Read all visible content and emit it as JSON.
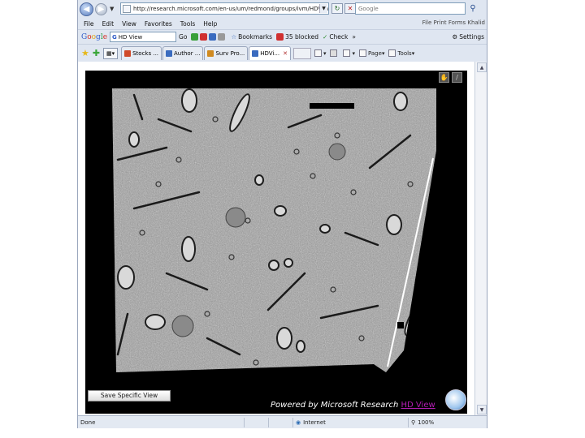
{
  "browser": {
    "address": "http://research.microsoft.com/en-us/um/redmond/groups/ivm/HDView/Connectome/iframe.htm",
    "search_placeholder": "Google",
    "menu": [
      "File",
      "Edit",
      "View",
      "Favorites",
      "Tools",
      "Help"
    ],
    "links_right": "File Print Forms Khalid"
  },
  "google_toolbar": {
    "search_value": "HD View",
    "go_label": "Go",
    "bookmarks_label": "Bookmarks",
    "blocked_label": "35 blocked",
    "check_label": "Check",
    "more_label": "»",
    "settings_label": "Settings"
  },
  "tabs": [
    {
      "label": "Stocks ...",
      "color": "#d04a2a",
      "active": false
    },
    {
      "label": "Author ...",
      "color": "#3a6bbf",
      "active": false
    },
    {
      "label": "Surv Pro...",
      "color": "#d08a20",
      "active": false
    },
    {
      "label": "HDVi...",
      "color": "#3a6bbf",
      "active": true
    }
  ],
  "command_bar": {
    "page_label": "Page",
    "tools_label": "Tools"
  },
  "page": {
    "save_button": "Save Specific View",
    "powered_prefix": "Powered by Microsoft Research",
    "powered_link": "HD View"
  },
  "status": {
    "left": "Done",
    "zone": "Internet",
    "zoom": "100%"
  },
  "colors": {
    "accent_link": "#b21db2",
    "chrome": "#dfe6f1"
  }
}
